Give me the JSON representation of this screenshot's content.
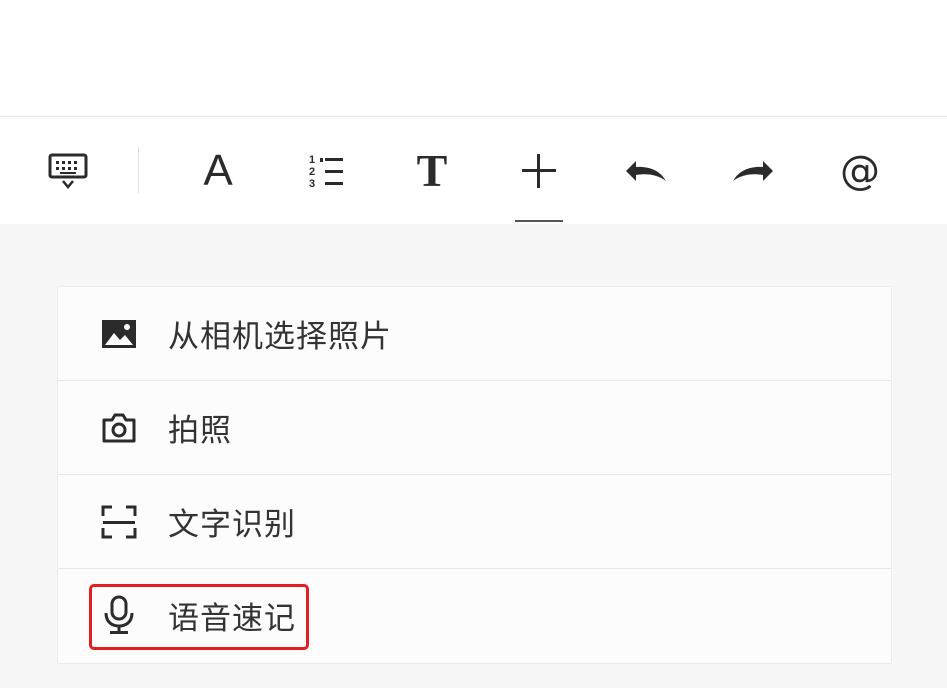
{
  "toolbar": {
    "tools": [
      {
        "icon": "keyboard-hide-icon"
      },
      {
        "icon": "font-icon",
        "glyph": "A"
      },
      {
        "icon": "numbered-list-icon"
      },
      {
        "icon": "text-style-icon",
        "glyph": "T"
      },
      {
        "icon": "plus-icon",
        "active": true
      },
      {
        "icon": "undo-icon"
      },
      {
        "icon": "redo-icon"
      },
      {
        "icon": "mention-icon",
        "glyph": "@"
      }
    ]
  },
  "insert_menu": {
    "items": [
      {
        "icon": "image-icon",
        "label": "从相机选择照片"
      },
      {
        "icon": "camera-icon",
        "label": "拍照"
      },
      {
        "icon": "scan-icon",
        "label": "文字识别"
      },
      {
        "icon": "microphone-icon",
        "label": "语音速记",
        "highlighted": true
      }
    ]
  },
  "colors": {
    "highlight": "#e02020",
    "icon": "#2b2b2b",
    "background": "#f6f6f6"
  }
}
